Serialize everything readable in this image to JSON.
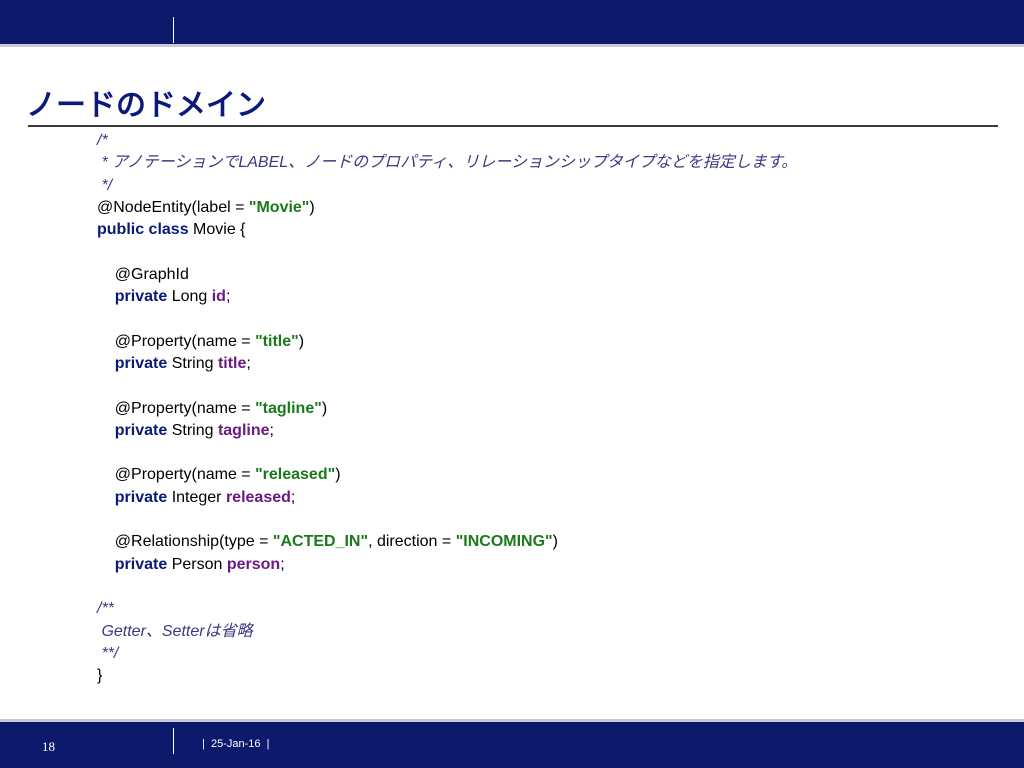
{
  "slide": {
    "title": "ノードのドメイン",
    "page_number": "18",
    "date": "|  25-Jan-16  |"
  },
  "code": {
    "comment_open": "/*",
    "comment_body": " * アノテーションでLABEL、ノードのプロパティ、リレーションシップタイプなどを指定します。",
    "comment_close": " */",
    "node_entity_prefix": "@NodeEntity(label = ",
    "node_entity_value": "\"Movie\"",
    "node_entity_suffix": ")",
    "class_keywords": "public class",
    "class_name": " Movie {",
    "graph_id": "    @GraphId",
    "id_keyword": "    private",
    "id_type": " Long ",
    "id_name": "id",
    "id_semicolon": ";",
    "title_annotation_prefix": "    @Property(name = ",
    "title_annotation_value": "\"title\"",
    "title_annotation_suffix": ")",
    "title_keyword": "    private",
    "title_type": " String ",
    "title_name": "title",
    "title_semicolon": ";",
    "tagline_annotation_prefix": "    @Property(name = ",
    "tagline_annotation_value": "\"tagline\"",
    "tagline_annotation_suffix": ")",
    "tagline_keyword": "    private",
    "tagline_type": " String ",
    "tagline_name": "tagline",
    "tagline_semicolon": ";",
    "released_annotation_prefix": "    @Property(name = ",
    "released_annotation_value": "\"released\"",
    "released_annotation_suffix": ")",
    "released_keyword": "    private",
    "released_type": " Integer ",
    "released_name": "released",
    "released_semicolon": ";",
    "relationship_prefix": "    @Relationship(type = ",
    "relationship_type_value": "\"ACTED_IN\"",
    "relationship_middle": ", direction = ",
    "relationship_direction_value": "\"INCOMING\"",
    "relationship_suffix": ")",
    "person_keyword": "    private",
    "person_type": " Person ",
    "person_name": "person",
    "person_semicolon": ";",
    "doc_open": "/**",
    "doc_body": " Getter、Setterは省略",
    "doc_close": " **/",
    "class_close": "}"
  }
}
